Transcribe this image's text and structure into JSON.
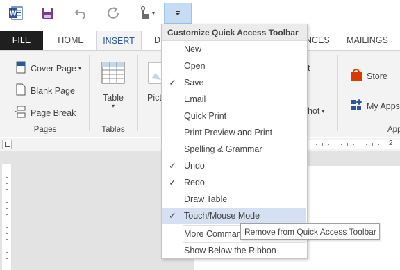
{
  "qat": {
    "word_icon": "word-logo-icon",
    "save_icon": "save-icon",
    "undo_icon": "undo-icon",
    "redo_icon": "redo-icon",
    "touch_icon": "touch-mode-icon",
    "customize_icon": "customize-dropdown-icon"
  },
  "tabs": {
    "file": "FILE",
    "home": "HOME",
    "insert": "INSERT",
    "design_partial": "D",
    "references_partial": "NCES",
    "mailings": "MAILINGS"
  },
  "ribbon": {
    "cover_page": "Cover Page",
    "blank_page": "Blank Page",
    "page_break": "Page Break",
    "pages_group": "Pages",
    "table": "Table",
    "tables_group": "Tables",
    "pictures_partial": "Pict",
    "store": "Store",
    "my_apps": "My Apps",
    "apps_partial": "App",
    "smartart_partial": "t",
    "screenshot_partial": "hot"
  },
  "ruler": {
    "tick_2": "2"
  },
  "menu": {
    "header": "Customize Quick Access Toolbar",
    "items": [
      {
        "label": "New",
        "checked": false
      },
      {
        "label": "Open",
        "checked": false
      },
      {
        "label": "Save",
        "checked": true
      },
      {
        "label": "Email",
        "checked": false
      },
      {
        "label": "Quick Print",
        "checked": false
      },
      {
        "label": "Print Preview and Print",
        "checked": false
      },
      {
        "label": "Spelling & Grammar",
        "checked": false
      },
      {
        "label": "Undo",
        "checked": true
      },
      {
        "label": "Redo",
        "checked": true
      },
      {
        "label": "Draw Table",
        "checked": false
      },
      {
        "label": "Touch/Mouse Mode",
        "checked": true
      }
    ],
    "more_commands": "More Commands...",
    "show_below": "Show Below the Ribbon",
    "checkmark": "✓"
  },
  "tooltip": {
    "text": "Remove from Quick Access Toolbar"
  },
  "colors": {
    "accent": "#2b579a",
    "file_tab": "#1f1f1f",
    "hover": "#d5e1f2",
    "store_red": "#d83b01",
    "apps_blue": "#2b579a"
  }
}
